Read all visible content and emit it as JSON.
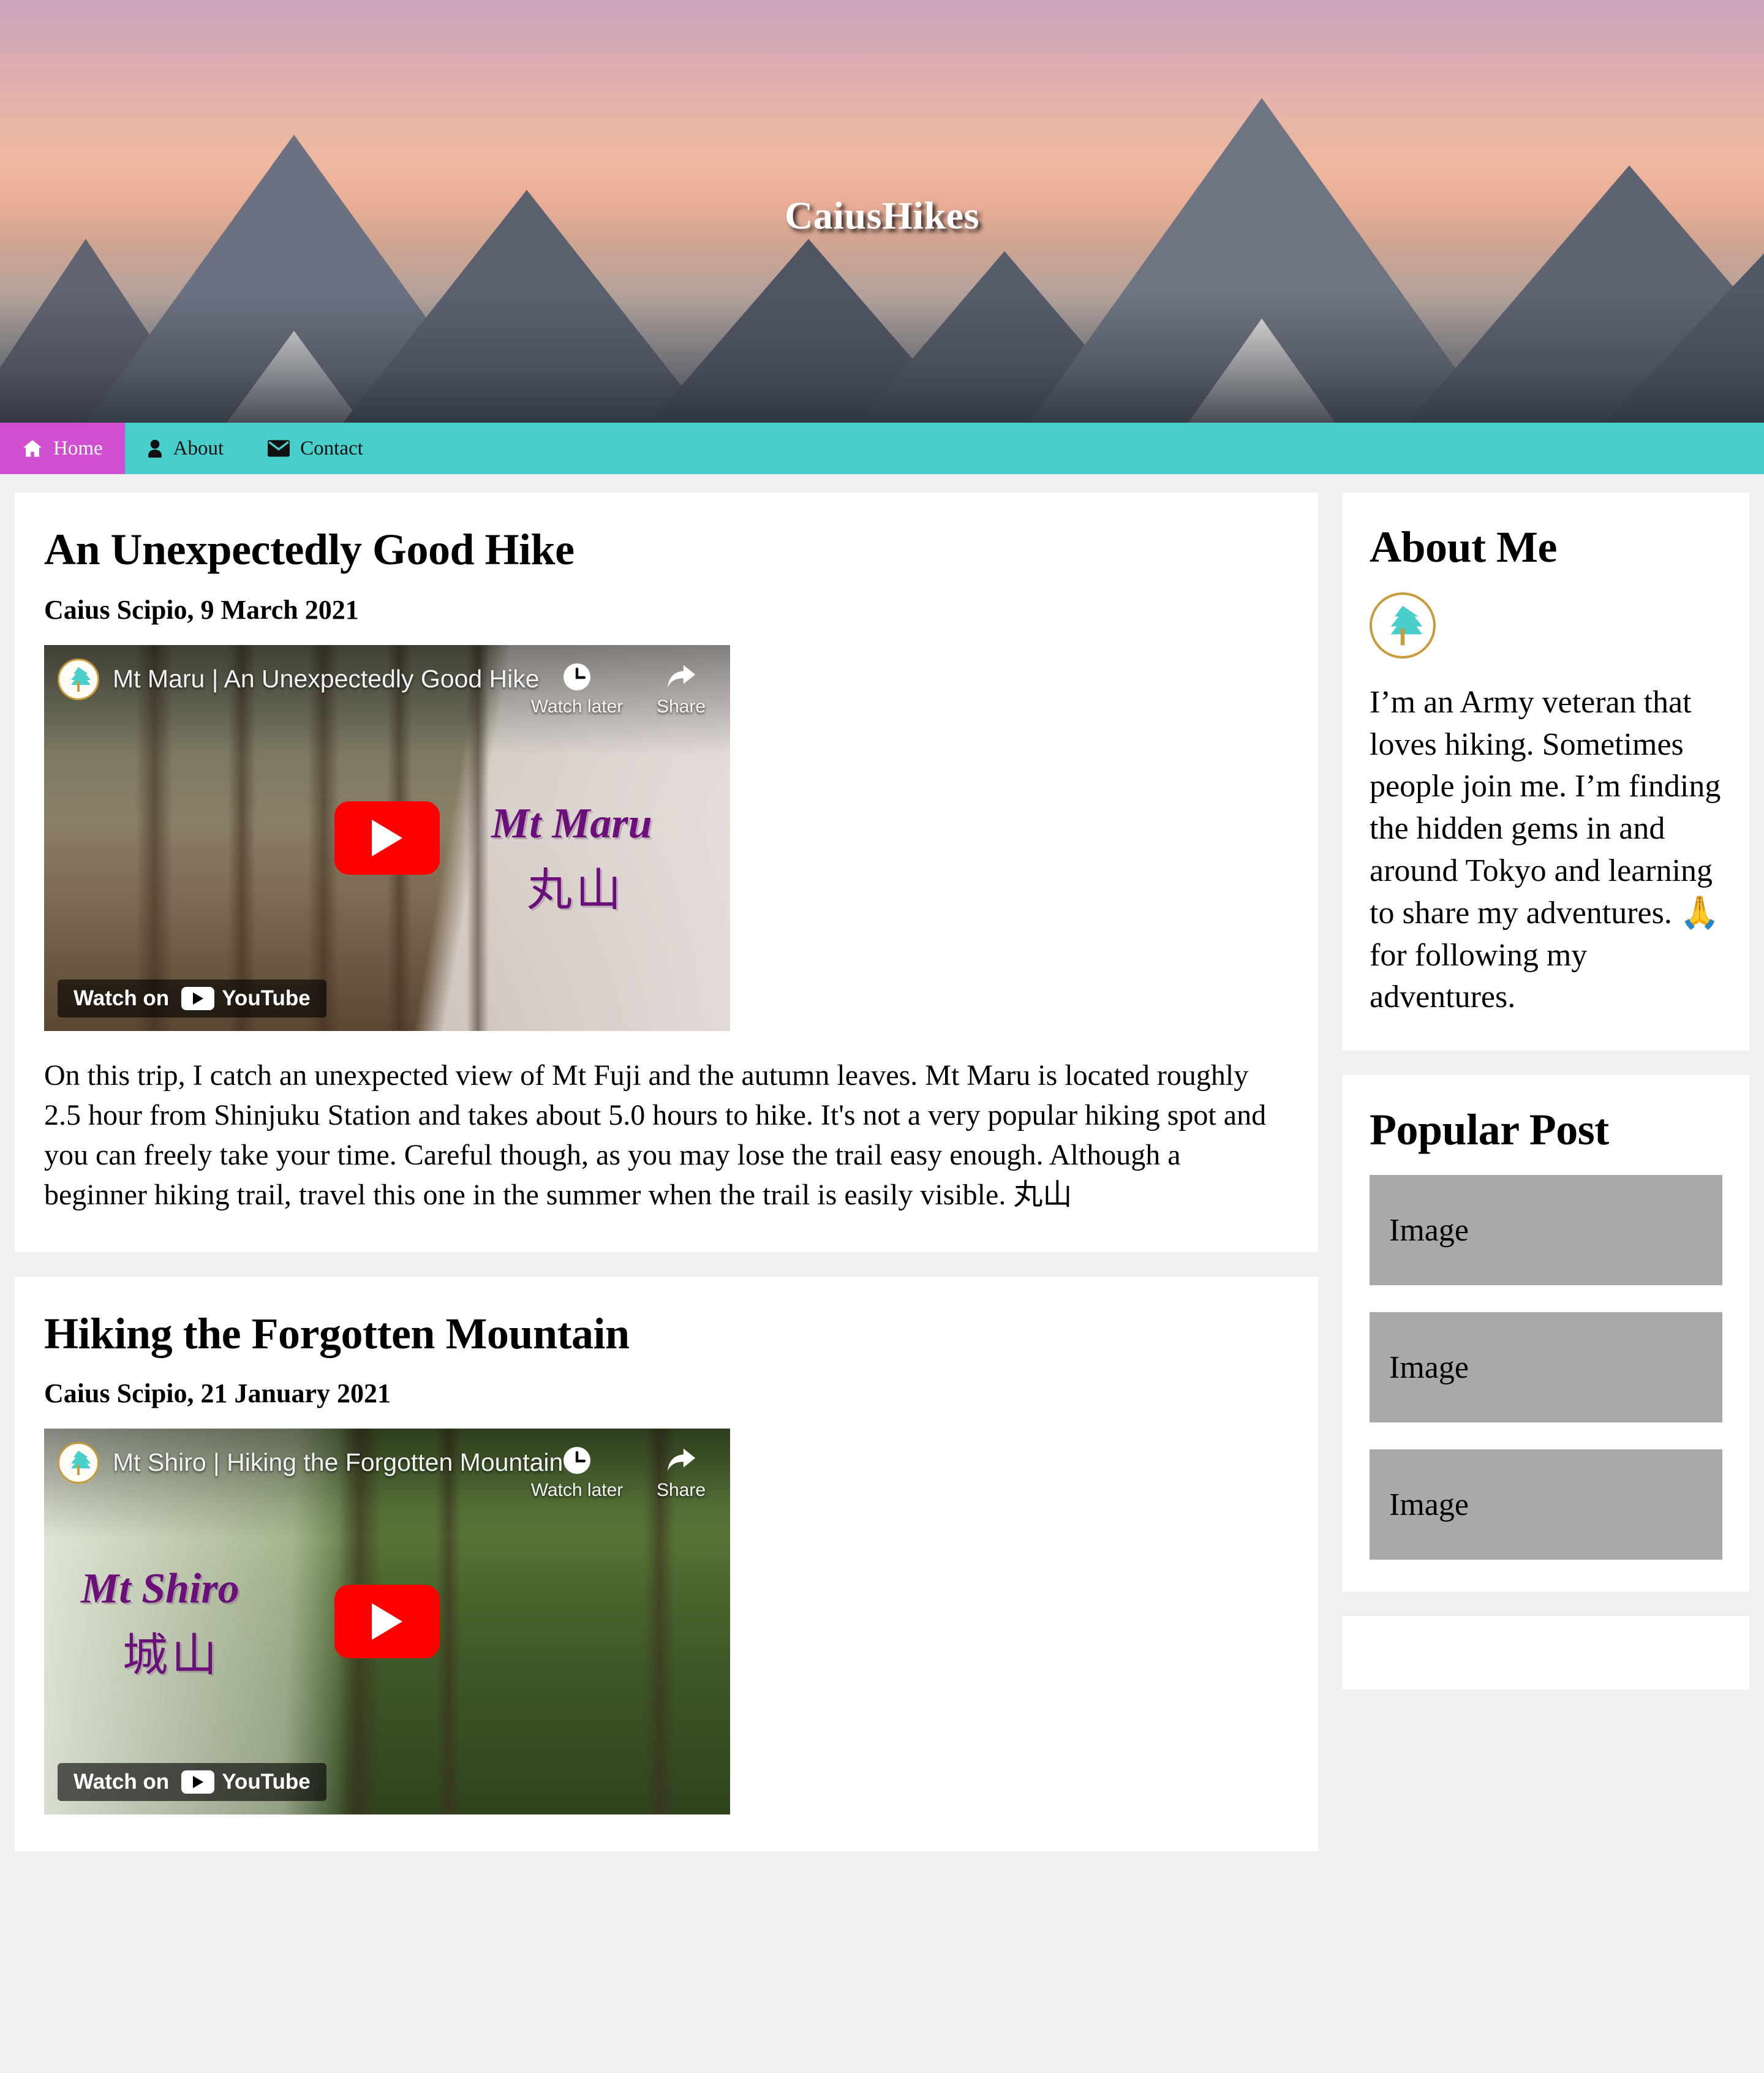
{
  "site": {
    "title": "CaiusHikes",
    "accent_magenta": "#cf4fd0",
    "accent_teal": "#48cfcb",
    "avatar_gold": "#c79a3a",
    "avatar_tree": "#48cfcb"
  },
  "nav": {
    "items": [
      {
        "label": "Home",
        "icon": "home-icon",
        "active": true
      },
      {
        "label": "About",
        "icon": "user-icon",
        "active": false
      },
      {
        "label": "Contact",
        "icon": "envelope-icon",
        "active": false
      }
    ]
  },
  "posts": [
    {
      "title": "An Unexpectedly Good Hike",
      "byline": "Caius Scipio, 9 March 2021",
      "video": {
        "title": "Mt Maru | An Unexpectedly Good Hike",
        "overlay_title": "Mt Maru",
        "overlay_sub": "丸山",
        "watch_later_label": "Watch later",
        "share_label": "Share",
        "watch_on_label": "Watch on",
        "youtube_label": "YouTube"
      },
      "body": "On this trip, I catch an unexpected view of Mt Fuji and the autumn leaves. Mt Maru is located roughly 2.5 hour from Shinjuku Station and takes about 5.0 hours to hike. It's not a very popular hiking spot and you can freely take your time. Careful though, as you may lose the trail easy enough. Although a beginner hiking trail, travel this one in the summer when the trail is easily visible. 丸山"
    },
    {
      "title": "Hiking the Forgotten Mountain",
      "byline": "Caius Scipio, 21 January 2021",
      "video": {
        "title": "Mt Shiro | Hiking the Forgotten Mountain",
        "overlay_title": "Mt Shiro",
        "overlay_sub": "城山",
        "watch_later_label": "Watch later",
        "share_label": "Share",
        "watch_on_label": "Watch on",
        "youtube_label": "YouTube"
      },
      "body": ""
    }
  ],
  "sidebar": {
    "about": {
      "heading": "About Me",
      "text_before_emoji": "I’m an Army veteran that loves hiking. Sometimes people join me. I’m finding the hidden gems in and around Tokyo and learning to share my adventures. ",
      "emoji": "🙏",
      "text_after_emoji": " for following my adventures."
    },
    "popular": {
      "heading": "Popular Post",
      "items": [
        {
          "label": "Image"
        },
        {
          "label": "Image"
        },
        {
          "label": "Image"
        }
      ]
    }
  }
}
